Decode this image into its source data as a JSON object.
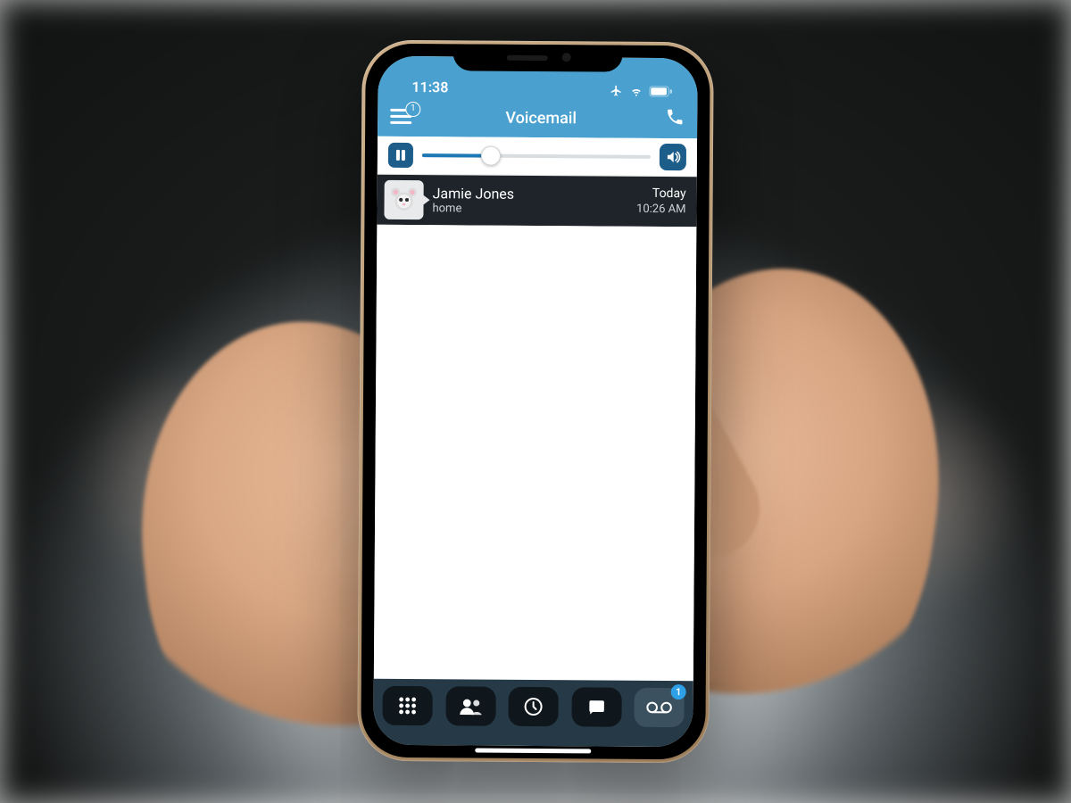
{
  "statusbar": {
    "time": "11:38"
  },
  "header": {
    "title": "Voicemail",
    "menu_badge": "1"
  },
  "player": {
    "progress_percent": 30
  },
  "voicemails": [
    {
      "name": "Jamie Jones",
      "label": "home",
      "day": "Today",
      "time": "10:26 AM"
    }
  ],
  "tabbar": {
    "voicemail_badge": "1"
  },
  "colors": {
    "accent": "#4aa1d0",
    "accent_dark": "#1c5e89",
    "tabbar_bg": "#253947",
    "row_bg": "#1e2429"
  }
}
